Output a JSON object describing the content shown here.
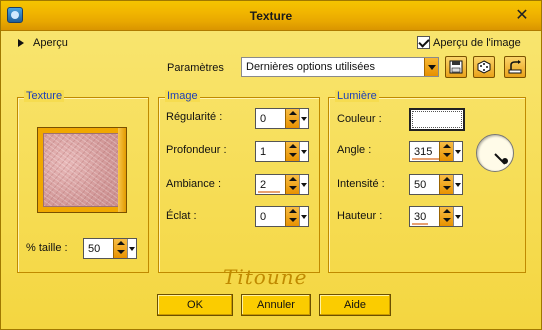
{
  "window": {
    "title": "Texture",
    "close_glyph": "✕"
  },
  "top": {
    "apercu_label": "Aperçu",
    "preview_label": "Aperçu de l'image",
    "preview_checked": true,
    "params_label": "Paramètres",
    "preset_value": "Dernières options utilisées"
  },
  "texture": {
    "title": "Texture",
    "size_label": "% taille :",
    "size_value": "50"
  },
  "image": {
    "title": "Image",
    "fields": [
      {
        "label": "Régularité :",
        "value": "0"
      },
      {
        "label": "Profondeur :",
        "value": "1"
      },
      {
        "label": "Ambiance :",
        "value": "2"
      },
      {
        "label": "Éclat :",
        "value": "0"
      }
    ]
  },
  "light": {
    "title": "Lumière",
    "color_label": "Couleur :",
    "color_value": "#ffffff",
    "fields": [
      {
        "label": "Angle :",
        "value": "315"
      },
      {
        "label": "Intensité :",
        "value": "50"
      },
      {
        "label": "Hauteur :",
        "value": "30"
      }
    ]
  },
  "signature": "Titoune",
  "buttons": {
    "ok": "OK",
    "cancel": "Annuler",
    "help": "Aide"
  },
  "icons": [
    "app-icon",
    "close-icon",
    "save-preset-icon",
    "randomize-icon",
    "reset-icon",
    "angle-dial-icon"
  ]
}
